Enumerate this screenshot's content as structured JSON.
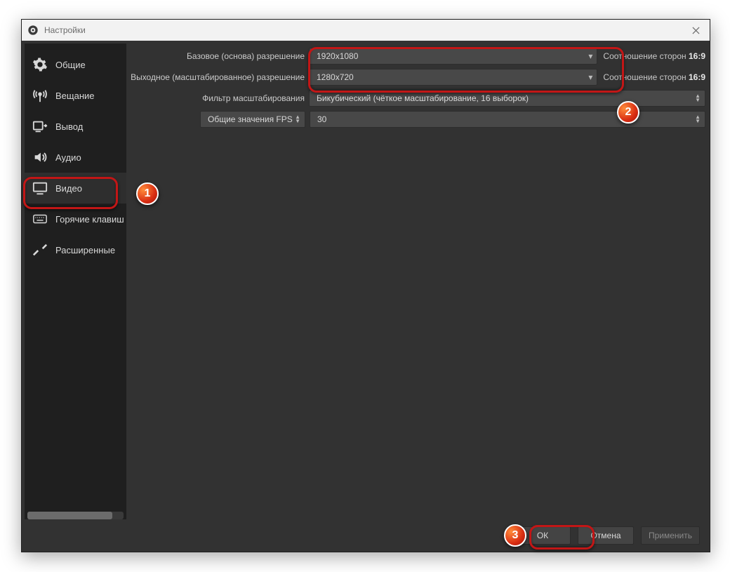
{
  "window": {
    "title": "Настройки"
  },
  "sidebar": {
    "items": [
      {
        "id": "general",
        "icon": "gear",
        "label": "Общие"
      },
      {
        "id": "stream",
        "icon": "broadcast",
        "label": "Вещание"
      },
      {
        "id": "output",
        "icon": "output",
        "label": "Вывод"
      },
      {
        "id": "audio",
        "icon": "audio",
        "label": "Аудио"
      },
      {
        "id": "video",
        "icon": "monitor",
        "label": "Видео",
        "selected": true
      },
      {
        "id": "hotkeys",
        "icon": "keyboard",
        "label": "Горячие клавиш"
      },
      {
        "id": "advanced",
        "icon": "tools",
        "label": "Расширенные"
      }
    ]
  },
  "video": {
    "base_resolution": {
      "label": "Базовое (основа) разрешение",
      "value": "1920x1080",
      "aspect_label": "Соотношение сторон",
      "aspect_value": "16:9"
    },
    "output_resolution": {
      "label": "Выходное (масштабированное) разрешение",
      "value": "1280x720",
      "aspect_label": "Соотношение сторон",
      "aspect_value": "16:9"
    },
    "downscale_filter": {
      "label": "Фильтр масштабирования",
      "value": "Бикубический (чёткое масштабирование, 16 выборок)"
    },
    "fps": {
      "label": "Общие значения FPS",
      "value": "30"
    }
  },
  "footer": {
    "ok": "ОК",
    "cancel": "Отмена",
    "apply": "Применить"
  },
  "annotations": {
    "badge1": "1",
    "badge2": "2",
    "badge3": "3"
  }
}
